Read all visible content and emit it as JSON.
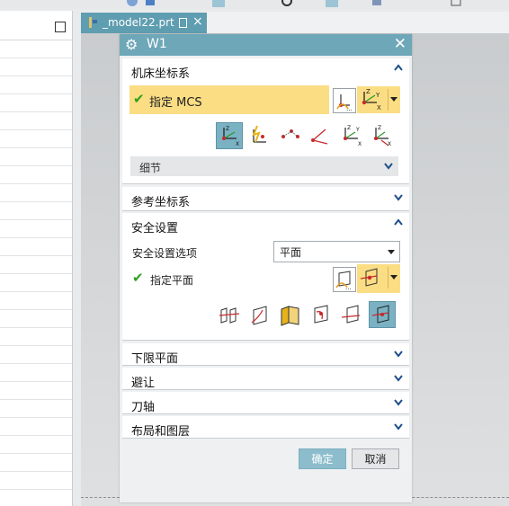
{
  "window_tab": {
    "title": "_model22.prt",
    "close_glyph": "×"
  },
  "dialog": {
    "title": "W1",
    "close_glyph": "✕",
    "groups": {
      "mcs": {
        "label": "机床坐标系",
        "specify_label": "指定 MCS",
        "details_label": "细节"
      },
      "ref_csys": {
        "label": "参考坐标系"
      },
      "clearance": {
        "label": "安全设置",
        "option_label": "安全设置选项",
        "option_value": "平面",
        "specify_label": "指定平面"
      },
      "lower_limit": {
        "label": "下限平面"
      },
      "avoidance": {
        "label": "避让"
      },
      "tool_axis": {
        "label": "刀轴"
      },
      "layout_layer": {
        "label": "布局和图层"
      }
    },
    "buttons": {
      "ok": "确定",
      "cancel": "取消"
    }
  },
  "colors": {
    "titlebar": "#6da7b8",
    "accent_yellow": "#fbdd84",
    "active_icon": "#7ab2c4",
    "check_green": "#2da01f"
  },
  "icons": [
    "gear-icon",
    "check-icon",
    "csys-dialog-icon",
    "csys-icon",
    "dynamic-csys-icon",
    "origin-point-icon",
    "plane-icon",
    "chevron-up-icon",
    "chevron-down-icon"
  ]
}
